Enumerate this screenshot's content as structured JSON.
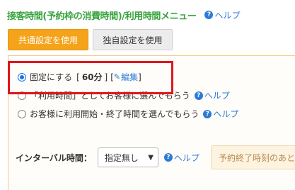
{
  "header": {
    "title": "接客時間(予約枠の消費時間)/利用時間メニュー",
    "help_label": "ヘルプ"
  },
  "tabs": [
    {
      "label": "共通設定を使用",
      "active": true
    },
    {
      "label": "独自設定を使用",
      "active": false
    }
  ],
  "options": [
    {
      "label": "固定にする",
      "selected": true,
      "minutes": "60分",
      "edit_label": "編集"
    },
    {
      "label": "「利用時間」としてお客様に選んでもらう",
      "selected": false,
      "help_label": "ヘルプ"
    },
    {
      "label": "お客様に利用開始・終了時間を選んでもらう",
      "selected": false,
      "help_label": "ヘルプ"
    }
  ],
  "interval": {
    "label": "インターバル時間：",
    "selected_value": "指定無し",
    "help_label": "ヘルプ",
    "note": "予約終了時刻のあと"
  },
  "colors": {
    "title_green": "#3aa340",
    "accent_orange": "#f5a31a",
    "link_blue": "#2b7bd6",
    "highlight_red": "#e0151b"
  }
}
